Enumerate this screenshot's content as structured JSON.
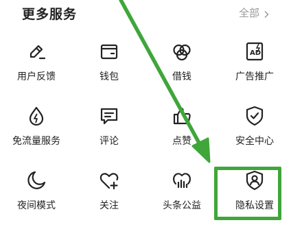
{
  "header": {
    "title": "更多服务",
    "see_all": "全部"
  },
  "services": [
    {
      "label": "用户反馈",
      "icon": "pencil-feedback-icon"
    },
    {
      "label": "钱包",
      "icon": "wallet-icon"
    },
    {
      "label": "借钱",
      "icon": "loan-icon"
    },
    {
      "label": "广告推广",
      "icon": "ad-icon"
    },
    {
      "label": "免流量服务",
      "icon": "data-drop-icon"
    },
    {
      "label": "评论",
      "icon": "comment-icon"
    },
    {
      "label": "点赞",
      "icon": "thumbs-up-icon"
    },
    {
      "label": "安全中心",
      "icon": "shield-check-icon"
    },
    {
      "label": "夜间模式",
      "icon": "moon-icon"
    },
    {
      "label": "关注",
      "icon": "heart-plus-icon"
    },
    {
      "label": "头条公益",
      "icon": "charity-icon"
    },
    {
      "label": "隐私设置",
      "icon": "privacy-shield-icon"
    }
  ],
  "annotation": {
    "arrow_color": "#3fa63a",
    "highlight_color": "#3fa63a"
  }
}
